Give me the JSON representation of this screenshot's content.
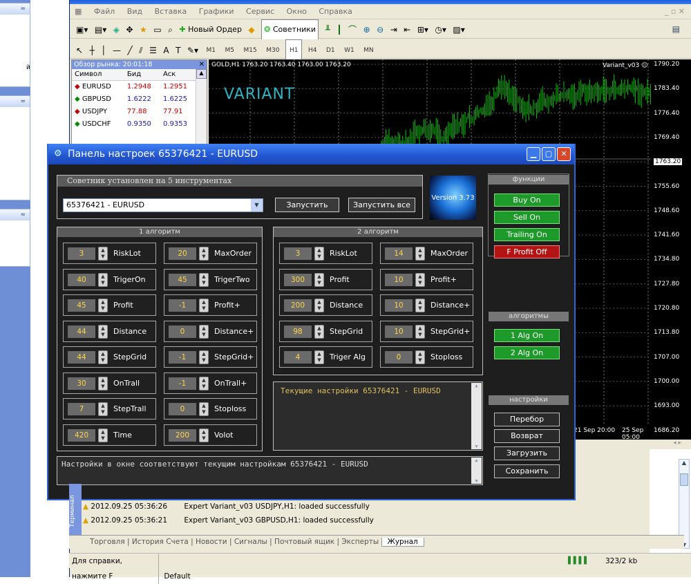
{
  "menu": [
    "Файл",
    "Вид",
    "Вставка",
    "Графики",
    "Сервис",
    "Окно",
    "Справка"
  ],
  "toolbar": {
    "new_order": "Новый Ордер",
    "advisors": "Советники"
  },
  "timeframes": [
    "M1",
    "M5",
    "M15",
    "M30",
    "H1",
    "H4",
    "D1",
    "W1",
    "MN"
  ],
  "market_watch": {
    "title": "Обзор рынка: 20:01:18",
    "headers": [
      "Символ",
      "Бид",
      "Аск"
    ],
    "rows": [
      {
        "symbol": "EURUSD",
        "bid": "1.2948",
        "ask": "1.2951",
        "dir": "down"
      },
      {
        "symbol": "GBPUSD",
        "bid": "1.6222",
        "ask": "1.6225",
        "dir": "up"
      },
      {
        "symbol": "USDJPY",
        "bid": "77.88",
        "ask": "77.91",
        "dir": "down"
      },
      {
        "symbol": "USDCHF",
        "bid": "0.9350",
        "ask": "0.9353",
        "dir": "up"
      }
    ]
  },
  "chart": {
    "info": "GOLD,H1  1763.20 1763.40 1763.00 1763.20",
    "watermark": "VARIANT",
    "indicator": "Variant_v03",
    "price_ticks": [
      "1790.20",
      "1783.40",
      "1776.40",
      "1769.40",
      "1763.20",
      "1755.60",
      "1748.60",
      "1741.60",
      "1734.80",
      "1727.80",
      "1720.80",
      "1713.80",
      "1707.00",
      "1700.00",
      "1693.00",
      "1686.20"
    ],
    "date_labels": [
      "21 Sep 20:00",
      "25 Sep 05:00"
    ],
    "colors": {
      "bars": "#00c800",
      "current": "#ffffff"
    }
  },
  "panel": {
    "title": "Панель настроек 65376421 - EURUSD",
    "installed": "Советник установлен на 5 инструментах",
    "account_select": "65376421 - EURUSD",
    "start": "Запустить",
    "start_all": "Запустить все",
    "version": "Version 3.73",
    "alg1_title": "1 алгоритм",
    "alg2_title": "2 алгоритм",
    "alg1_left": [
      {
        "v": "3",
        "l": "RiskLot"
      },
      {
        "v": "40",
        "l": "TrigerOn"
      },
      {
        "v": "45",
        "l": "Profit"
      },
      {
        "v": "44",
        "l": "Distance"
      },
      {
        "v": "44",
        "l": "StepGrid"
      },
      {
        "v": "30",
        "l": "OnTrall"
      },
      {
        "v": "7",
        "l": "StepTrall"
      },
      {
        "v": "420",
        "l": "Time"
      }
    ],
    "alg1_right": [
      {
        "v": "20",
        "l": "MaxOrder"
      },
      {
        "v": "45",
        "l": "TrigerTwo"
      },
      {
        "v": "-1",
        "l": "Profit+"
      },
      {
        "v": "0",
        "l": "Distance+"
      },
      {
        "v": "-1",
        "l": "StepGrid+"
      },
      {
        "v": "-1",
        "l": "OnTrall+"
      },
      {
        "v": "0",
        "l": "Stoploss"
      },
      {
        "v": "200",
        "l": "Volot"
      }
    ],
    "alg2_left": [
      {
        "v": "3",
        "l": "RiskLot"
      },
      {
        "v": "300",
        "l": "Profit"
      },
      {
        "v": "200",
        "l": "Distance"
      },
      {
        "v": "98",
        "l": "StepGrid"
      },
      {
        "v": "4",
        "l": "Triger Alg"
      }
    ],
    "alg2_right": [
      {
        "v": "14",
        "l": "MaxOrder"
      },
      {
        "v": "10",
        "l": "Profit+"
      },
      {
        "v": "10",
        "l": "Distance+"
      },
      {
        "v": "10",
        "l": "StepGrid+"
      },
      {
        "v": "0",
        "l": "Stoploss"
      }
    ],
    "current_settings": "Текущие настройки  65376421 - EURUSD",
    "status_msg": "Настройки в окне соответствуют текущим настройкам  65376421 - EURUSD",
    "functions_title": "функции",
    "functions": [
      {
        "l": "Buy On",
        "c": "green"
      },
      {
        "l": "Sell On",
        "c": "green"
      },
      {
        "l": "Trailing On",
        "c": "green"
      },
      {
        "l": "F Profit Off",
        "c": "red"
      }
    ],
    "algorithms_title": "алгоритмы",
    "algorithms": [
      "1 Alg On",
      "2 Alg On"
    ],
    "settings_title": "настройки",
    "settings": [
      "Перебор",
      "Возврат",
      "Загрузить",
      "Сохранить"
    ]
  },
  "journal": {
    "rows": [
      {
        "time": "2012.09.25 05:36:26",
        "msg": "Expert Variant_v03 USDJPY,H1: loaded successfully"
      },
      {
        "time": "2012.09.25 05:36:21",
        "msg": "Expert Variant_v03 GBPUSD,H1: loaded successfully"
      }
    ],
    "side_label": "Терминал",
    "tabs": [
      "Торговля",
      "История Счета",
      "Новости",
      "Сигналы",
      "Почтовый ящик",
      "Эксперты",
      "Журнал"
    ]
  },
  "status": {
    "help": "Для справки, нажмите F",
    "profile": "Default",
    "traffic": "323/2 kb"
  }
}
